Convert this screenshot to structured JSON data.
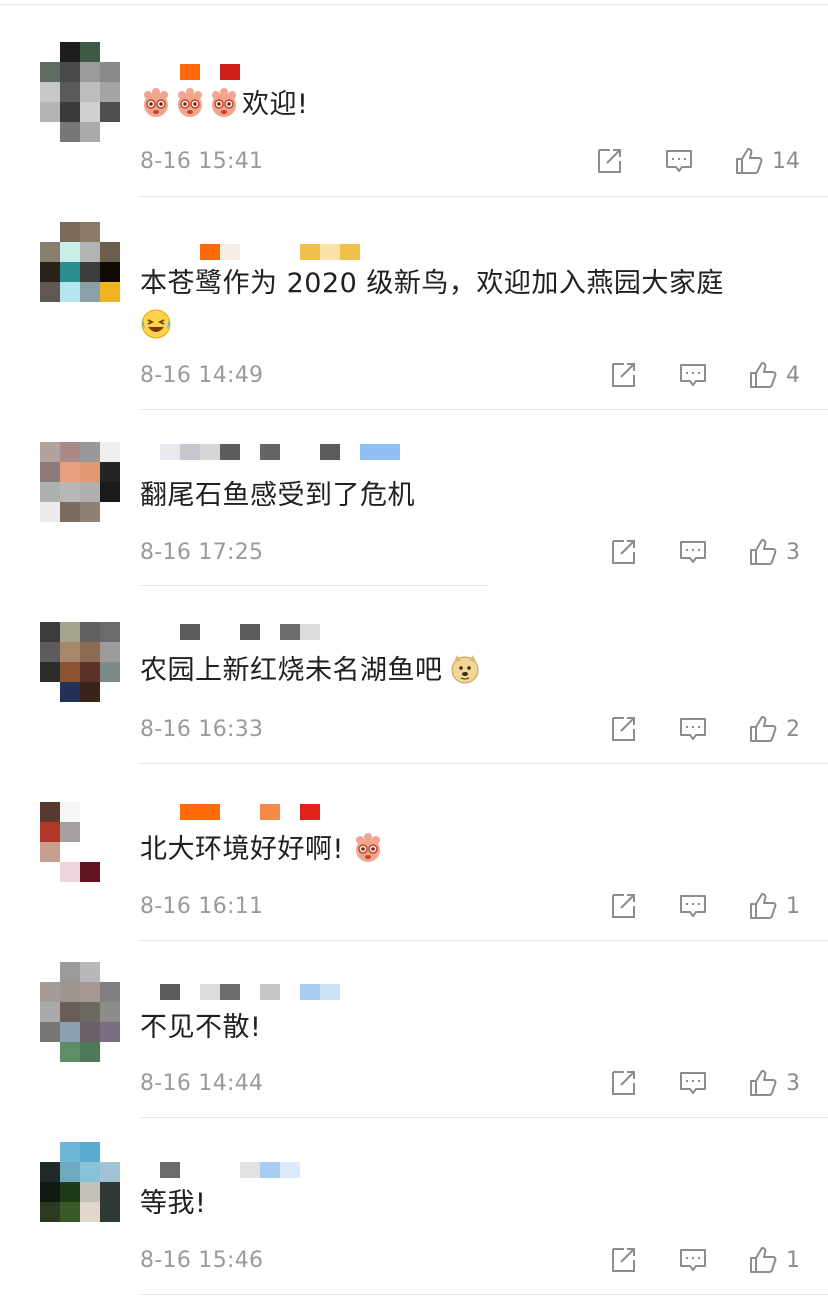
{
  "comments": [
    {
      "text": "欢迎!",
      "emojis": [
        "paw"
      ],
      "time": "8-16 15:41",
      "likes": "14"
    },
    {
      "text": "本苍鹭作为 2020 级新鸟，欢迎加入燕园大家庭",
      "emojis_after": [
        "laugh-cry"
      ],
      "time": "8-16 14:49",
      "likes": "4"
    },
    {
      "text": "翻尾石鱼感受到了危机",
      "time": "8-16 17:25",
      "likes": "3"
    },
    {
      "text": "农园上新红烧未名湖鱼吧",
      "emojis_after": [
        "doge"
      ],
      "time": "8-16 16:33",
      "likes": "2"
    },
    {
      "text": "北大环境好好啊!",
      "emojis_after": [
        "paw"
      ],
      "time": "8-16 16:11",
      "likes": "1"
    },
    {
      "text": "不见不散!",
      "time": "8-16 14:44",
      "likes": "3"
    },
    {
      "text": "等我!",
      "time": "8-16 15:46",
      "likes": "1"
    }
  ],
  "icons": {
    "share": "share-icon",
    "reply": "comment-icon",
    "like": "thumbs-up-icon"
  },
  "colors": {
    "timestamp": "#9a9a9a",
    "divider": "#e7e7e7",
    "icon": "#8c8c8c"
  }
}
